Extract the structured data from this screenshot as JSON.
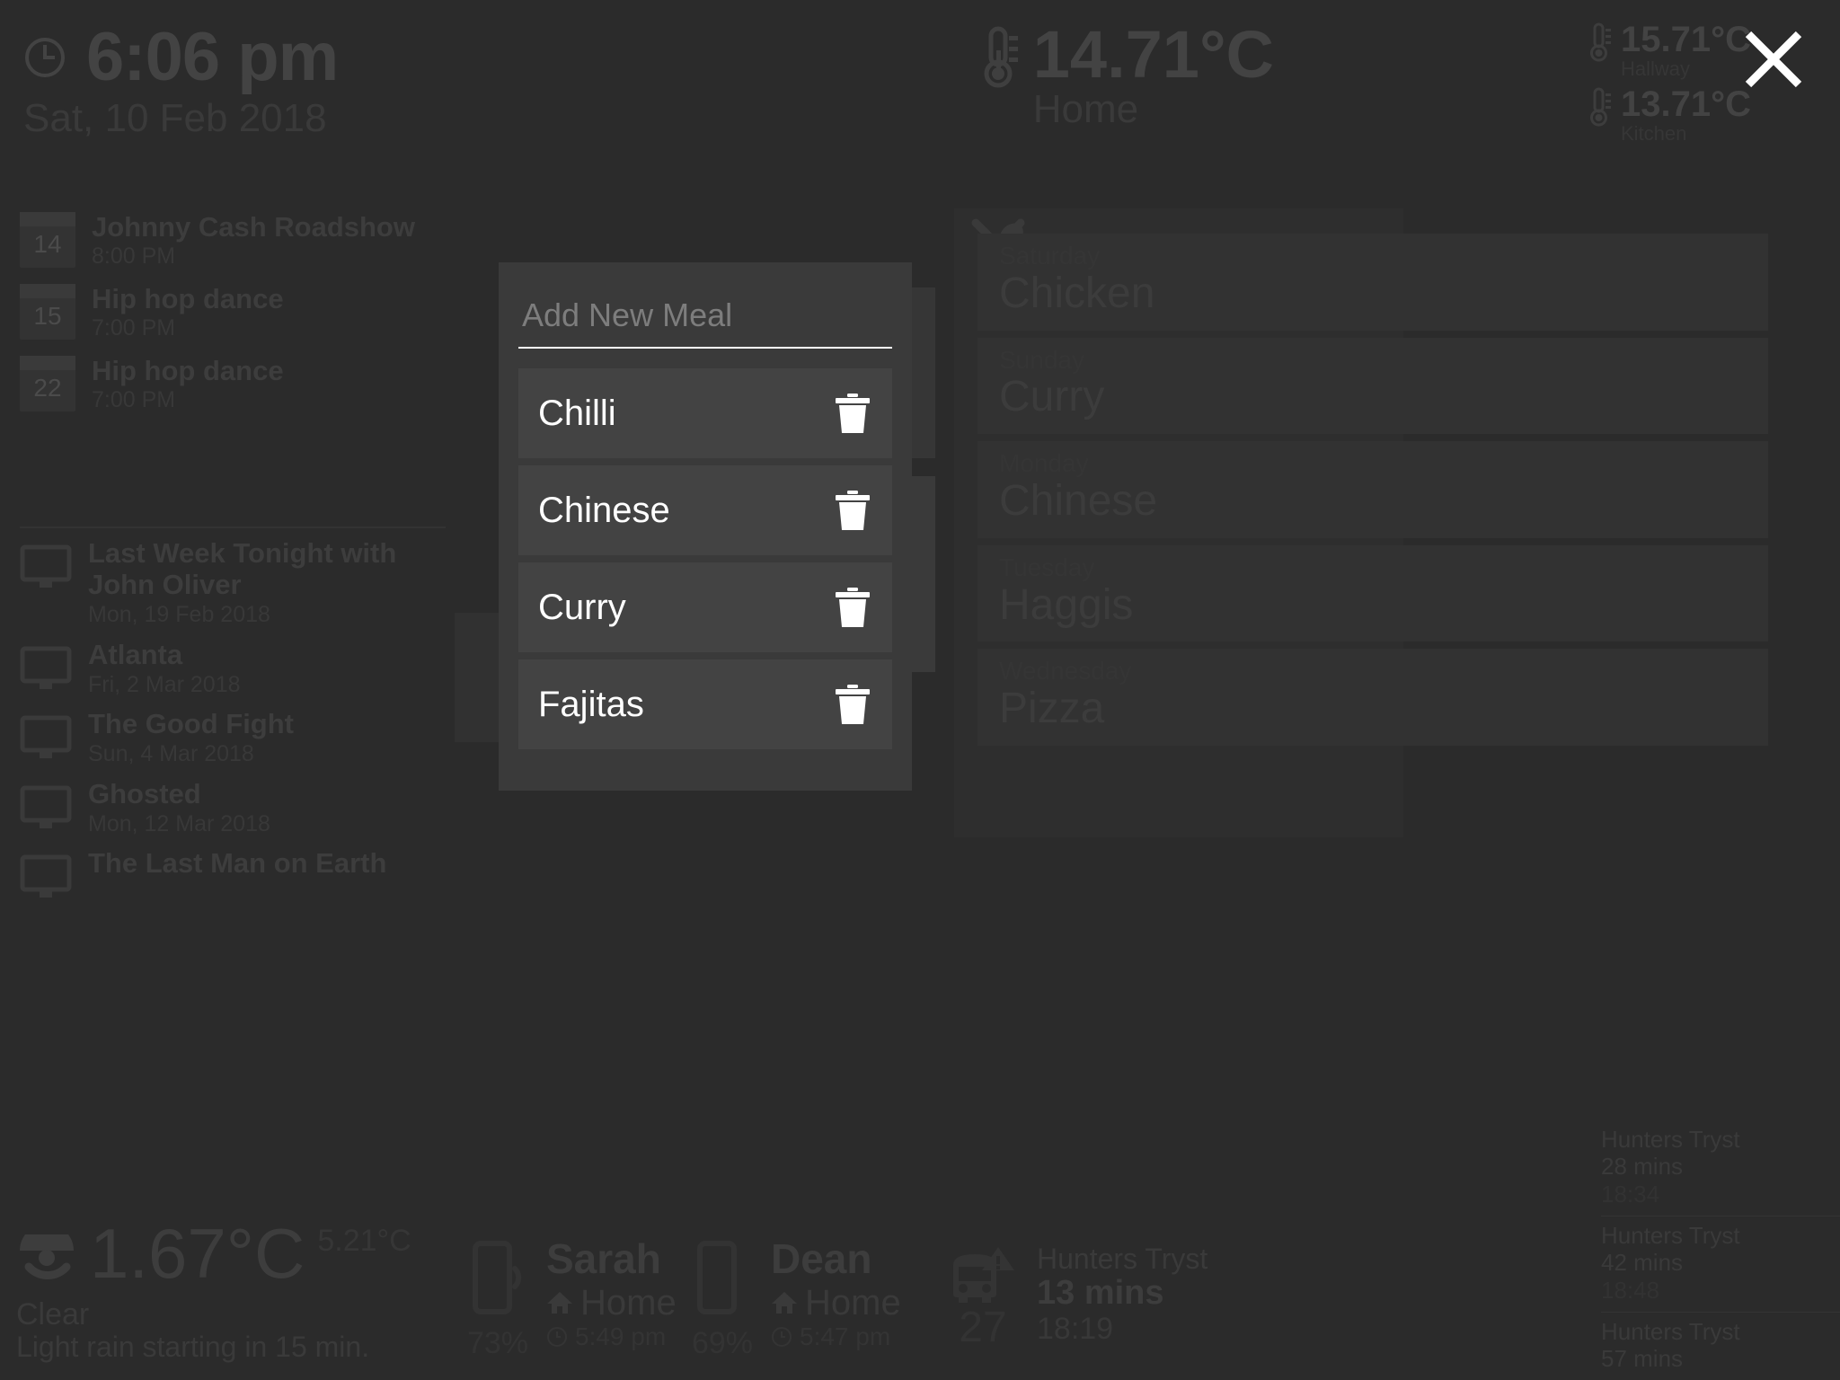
{
  "clock": {
    "icon": "clock-icon",
    "time": "6:06 pm",
    "date": "Sat, 10 Feb 2018"
  },
  "home_temperature": {
    "icon": "thermometer-icon",
    "value": "14.71°C",
    "label": "Home"
  },
  "rooms": [
    {
      "icon": "thermometer-icon",
      "value": "15.71°C",
      "name": "Hallway"
    },
    {
      "icon": "thermometer-icon",
      "value": "13.71°C",
      "name": "Kitchen"
    }
  ],
  "close_button": {
    "icon": "close-icon",
    "label": "×"
  },
  "calendar": {
    "events": [
      {
        "day": "14",
        "title": "Johnny Cash Roadshow",
        "time": "8:00 PM"
      },
      {
        "day": "15",
        "title": "Hip hop dance",
        "time": "7:00 PM"
      },
      {
        "day": "22",
        "title": "Hip hop dance",
        "time": "7:00 PM"
      }
    ]
  },
  "tv_shows": [
    {
      "icon": "tv-icon",
      "title": "Last Week Tonight with John Oliver",
      "date": "Mon, 19 Feb 2018"
    },
    {
      "icon": "tv-icon",
      "title": "Atlanta",
      "date": "Fri, 2 Mar 2018"
    },
    {
      "icon": "tv-icon",
      "title": "The Good Fight",
      "date": "Sun, 4 Mar 2018"
    },
    {
      "icon": "tv-icon",
      "title": "Ghosted",
      "date": "Mon, 12 Mar 2018"
    },
    {
      "icon": "tv-icon",
      "title": "The Last Man on Earth",
      "date": ""
    }
  ],
  "weather": {
    "icon": "clear-night-icon",
    "temperature": "1.67°C",
    "high": "5.21°C",
    "summary": "Clear",
    "detail": "Light rain starting in 15 min."
  },
  "phones": [
    {
      "icon": "phone-ringing-icon",
      "battery": "73%",
      "name": "Sarah",
      "location_icon": "home-icon",
      "location": "Home",
      "time_icon": "clock-icon",
      "time": "5:49 pm"
    },
    {
      "icon": "phone-icon",
      "battery": "69%",
      "name": "Dean",
      "location_icon": "home-icon",
      "location": "Home",
      "time_icon": "clock-icon",
      "time": "5:47 pm"
    }
  ],
  "bus": {
    "icon": "bus-alert-icon",
    "number": "27",
    "stop": "Hunters Tryst",
    "eta": "13 mins",
    "time": "18:19"
  },
  "bus_departures": [
    {
      "stop": "Hunters Tryst",
      "mins": "28 mins",
      "time": "18:34"
    },
    {
      "stop": "Hunters Tryst",
      "mins": "42 mins",
      "time": "18:48"
    },
    {
      "stop": "Hunters Tryst",
      "mins": "57 mins",
      "time": ""
    }
  ],
  "meal_plan": {
    "icon": "cutlery-icon",
    "days": [
      {
        "dow": "Saturday",
        "meal": "Chicken"
      },
      {
        "dow": "Sunday",
        "meal": "Curry"
      },
      {
        "dow": "Monday",
        "meal": "Chinese"
      },
      {
        "dow": "Tuesday",
        "meal": "Haggis"
      },
      {
        "dow": "Wednesday",
        "meal": "Pizza"
      }
    ]
  },
  "modal": {
    "input": {
      "value": "",
      "placeholder": "Add New Meal"
    },
    "meals": [
      {
        "name": "Chilli",
        "delete_icon": "trash-icon"
      },
      {
        "name": "Chinese",
        "delete_icon": "trash-icon"
      },
      {
        "name": "Curry",
        "delete_icon": "trash-icon"
      },
      {
        "name": "Fajitas",
        "delete_icon": "trash-icon"
      }
    ]
  },
  "colors": {
    "background": "#2b2b2b",
    "modal_background": "#3a3a3a",
    "row_background": "#434343",
    "text_primary": "#ffffff",
    "text_placeholder": "#7d7d7d",
    "dimmed_text": "#3a3a3a"
  }
}
